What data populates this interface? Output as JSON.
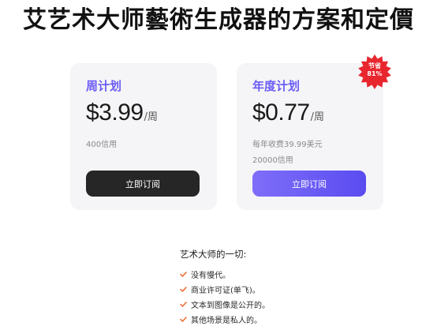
{
  "page": {
    "title": "艾艺术大师藝術生成器的方案和定價"
  },
  "colors": {
    "accent_purple": "#6b5cf5",
    "button_dark": "#262626",
    "badge_red": "#e8262e",
    "check_orange": "#f0672a",
    "card_bg": "#f5f5f7"
  },
  "plans": [
    {
      "name": "周计划",
      "price": "$3.99",
      "unit": "/周",
      "credits": "400信用",
      "button_label": "立即订阅"
    },
    {
      "name": "年度计划",
      "price": "$0.77",
      "unit": "/周",
      "billing_note": "每年收费39.99美元",
      "credits": "20000信用",
      "button_label": "立即订阅",
      "badge": {
        "line1": "节省",
        "line2": "81%"
      }
    }
  ],
  "features": {
    "heading": "艺术大师的一切:",
    "icon": "check-icon",
    "items": [
      "没有慢代。",
      "商业许可证(单飞)。",
      "文本到图像是公开的。",
      "其他场景是私人的。"
    ]
  }
}
